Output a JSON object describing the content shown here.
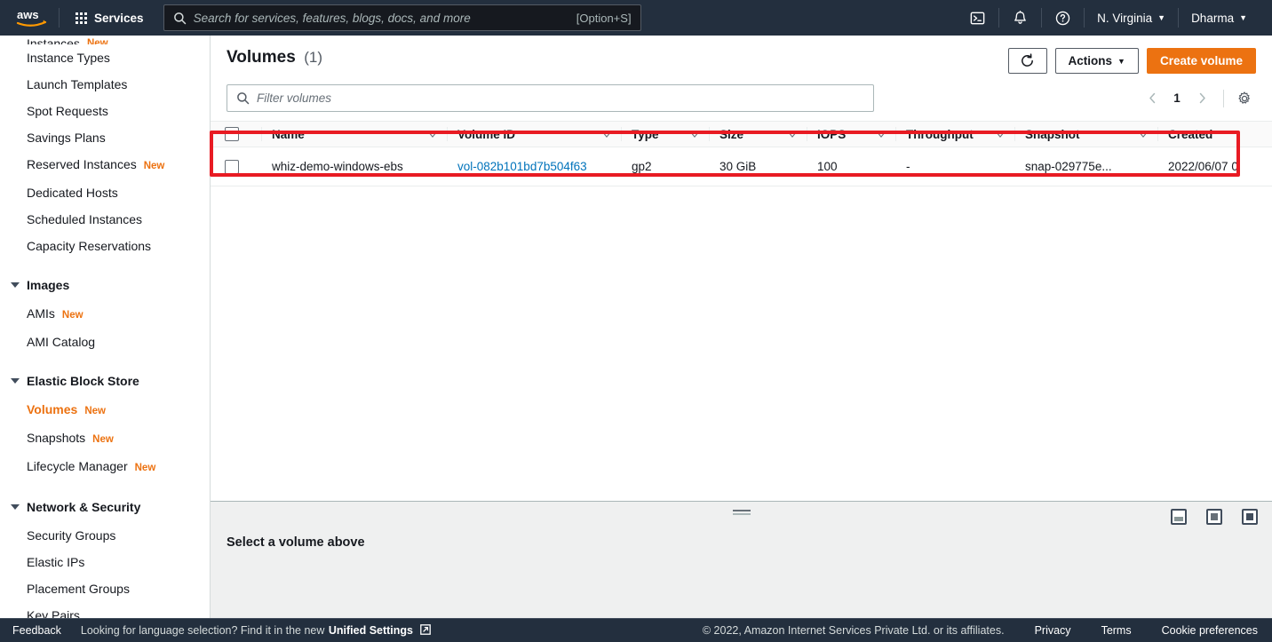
{
  "topnav": {
    "logo": "aws-logo",
    "services_label": "Services",
    "search_placeholder": "Search for services, features, blogs, docs, and more",
    "search_value": "",
    "search_shortcut": "[Option+S]",
    "cloudshell_icon": "cloudshell-icon",
    "notifications_icon": "bell-icon",
    "help_icon": "question-circle-icon",
    "region": "N. Virginia",
    "account": "Dharma"
  },
  "sidebar": {
    "items": [
      {
        "label": "Instances",
        "badge": "New",
        "type": "link",
        "clipped": true,
        "active": false
      },
      {
        "label": "Instance Types",
        "badge": "",
        "type": "link",
        "clipped": false,
        "active": false
      },
      {
        "label": "Launch Templates",
        "badge": "",
        "type": "link",
        "clipped": false,
        "active": false
      },
      {
        "label": "Spot Requests",
        "badge": "",
        "type": "link",
        "clipped": false,
        "active": false
      },
      {
        "label": "Savings Plans",
        "badge": "",
        "type": "link",
        "clipped": false,
        "active": false
      },
      {
        "label": "Reserved Instances",
        "badge": "New",
        "type": "link",
        "clipped": false,
        "active": false
      },
      {
        "label": "Dedicated Hosts",
        "badge": "",
        "type": "link",
        "clipped": false,
        "active": false
      },
      {
        "label": "Scheduled Instances",
        "badge": "",
        "type": "link",
        "clipped": false,
        "active": false
      },
      {
        "label": "Capacity Reservations",
        "badge": "",
        "type": "link",
        "clipped": false,
        "active": false
      },
      {
        "label": "Images",
        "badge": "",
        "type": "section",
        "clipped": false,
        "active": false
      },
      {
        "label": "AMIs",
        "badge": "New",
        "type": "link",
        "clipped": false,
        "active": false
      },
      {
        "label": "AMI Catalog",
        "badge": "",
        "type": "link",
        "clipped": false,
        "active": false
      },
      {
        "label": "Elastic Block Store",
        "badge": "",
        "type": "section",
        "clipped": false,
        "active": false
      },
      {
        "label": "Volumes",
        "badge": "New",
        "type": "link",
        "clipped": false,
        "active": true
      },
      {
        "label": "Snapshots",
        "badge": "New",
        "type": "link",
        "clipped": false,
        "active": false
      },
      {
        "label": "Lifecycle Manager",
        "badge": "New",
        "type": "link",
        "clipped": false,
        "active": false
      },
      {
        "label": "Network & Security",
        "badge": "",
        "type": "section",
        "clipped": false,
        "active": false
      },
      {
        "label": "Security Groups",
        "badge": "",
        "type": "link",
        "clipped": false,
        "active": false
      },
      {
        "label": "Elastic IPs",
        "badge": "",
        "type": "link",
        "clipped": false,
        "active": false
      },
      {
        "label": "Placement Groups",
        "badge": "",
        "type": "link",
        "clipped": false,
        "active": false
      },
      {
        "label": "Key Pairs",
        "badge": "",
        "type": "link",
        "clipped": false,
        "active": false
      }
    ]
  },
  "header": {
    "title": "Volumes",
    "count": "(1)",
    "refresh_icon": "refresh-icon",
    "actions_label": "Actions",
    "create_label": "Create volume",
    "filter_placeholder": "Filter volumes",
    "filter_value": "",
    "search_icon": "search-icon",
    "prev_icon": "chevron-left-icon",
    "next_icon": "chevron-right-icon",
    "page_number": "1",
    "settings_icon": "gear-icon"
  },
  "table": {
    "columns": [
      {
        "label": "Name",
        "sortable": true
      },
      {
        "label": "Volume ID",
        "sortable": true
      },
      {
        "label": "Type",
        "sortable": true
      },
      {
        "label": "Size",
        "sortable": true
      },
      {
        "label": "IOPS",
        "sortable": true
      },
      {
        "label": "Throughput",
        "sortable": true
      },
      {
        "label": "Snapshot",
        "sortable": true
      },
      {
        "label": "Created",
        "sortable": false
      }
    ],
    "rows": [
      {
        "name": "whiz-demo-windows-ebs",
        "volume_id": "vol-082b101bd7b504f63",
        "type": "gp2",
        "size": "30 GiB",
        "iops": "100",
        "throughput": "-",
        "snapshot": "snap-029775e...",
        "created": "2022/06/07 0"
      }
    ]
  },
  "split_panel": {
    "title": "Select a volume above",
    "drag_handle": "resize-handle",
    "position_icons": [
      "panel-bottom-icon",
      "panel-side-icon",
      "panel-full-icon"
    ]
  },
  "footer": {
    "feedback": "Feedback",
    "language_text": "Looking for language selection? Find it in the new",
    "unified_settings": "Unified Settings",
    "external_icon": "external-link-icon",
    "copyright": "© 2022, Amazon Internet Services Private Ltd. or its affiliates.",
    "privacy": "Privacy",
    "terms": "Terms",
    "cookie": "Cookie preferences"
  },
  "colors": {
    "brand_orange": "#ec7211",
    "nav_dark": "#232f3e",
    "link_blue": "#0073bb",
    "annotation_red": "#e81b23"
  }
}
